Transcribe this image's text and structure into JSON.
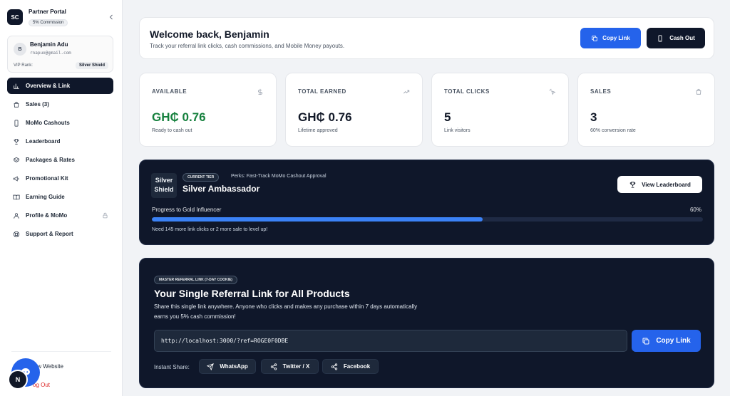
{
  "brand": {
    "logo": "SC",
    "name": "Partner Portal",
    "badge": "5% Commission"
  },
  "user": {
    "avatar": "B",
    "name": "Benjamin Adu",
    "email": "rnapuo@gmail.com",
    "rank_label": "VIP Rank:",
    "rank": "Silver Shield"
  },
  "nav": [
    {
      "label": "Overview & Link",
      "icon": "bar-chart-icon",
      "active": true
    },
    {
      "label": "Sales (3)",
      "icon": "shopping-bag-icon"
    },
    {
      "label": "MoMo Cashouts",
      "icon": "smartphone-icon"
    },
    {
      "label": "Leaderboard",
      "icon": "trophy-icon"
    },
    {
      "label": "Packages & Rates",
      "icon": "layers-icon"
    },
    {
      "label": "Promotional Kit",
      "icon": "megaphone-icon"
    },
    {
      "label": "Earning Guide",
      "icon": "book-icon"
    },
    {
      "label": "Profile & MoMo",
      "icon": "user-icon",
      "locked": true
    },
    {
      "label": "Support & Report",
      "icon": "lifebuoy-icon"
    }
  ],
  "bottom_links": {
    "view_website": "iew Website",
    "logout": "og Out"
  },
  "fab": {
    "badge": "N"
  },
  "header": {
    "title": "Welcome back, Benjamin",
    "subtitle": "Track your referral link clicks, cash commissions, and Mobile Money payouts.",
    "copy_link": "Copy Link",
    "cash_out": "Cash Out"
  },
  "stats": [
    {
      "label": "AVAILABLE",
      "value": "GH₵ 0.76",
      "note": "Ready to cash out",
      "icon": "dollar-icon"
    },
    {
      "label": "TOTAL EARNED",
      "value": "GH₵ 0.76",
      "note": "Lifetime approved",
      "icon": "trending-up-icon"
    },
    {
      "label": "TOTAL CLICKS",
      "value": "5",
      "note": "Link visitors",
      "icon": "cursor-click-icon"
    },
    {
      "label": "SALES",
      "value": "3",
      "note": "60% conversion rate",
      "icon": "shopping-bag-icon"
    }
  ],
  "tier": {
    "badge_line1": "Silver",
    "badge_line2": "Shield",
    "tag": "CURRENT TIER",
    "perk": "Perks: Fast-Track MoMo Cashout Approval",
    "name": "Silver Ambassador",
    "leaderboard_button": "View Leaderboard",
    "progress_label": "Progress to Gold Influencer",
    "progress_percent_text": "60%",
    "progress_fraction": 0.6,
    "progress_note": "Need 145 more link clicks or 2 more sale to level up!"
  },
  "referral": {
    "tag": "MASTER REFERRAL LINK (7-DAY COOKIE)",
    "title": "Your Single Referral Link for All Products",
    "description": "Share this single link anywhere. Anyone who clicks and makes any purchase within 7 days automatically earns you 5% cash commission!",
    "link": "http://localhost:3000/?ref=ROGE0F0DBE",
    "copy_button": "Copy Link",
    "share_label": "Instant Share:",
    "share": {
      "whatsapp": "WhatsApp",
      "twitter": "Twitter / X",
      "facebook": "Facebook"
    }
  },
  "colors": {
    "accent": "#2563eb",
    "dark": "#0f172a",
    "positive": "#15803d"
  }
}
